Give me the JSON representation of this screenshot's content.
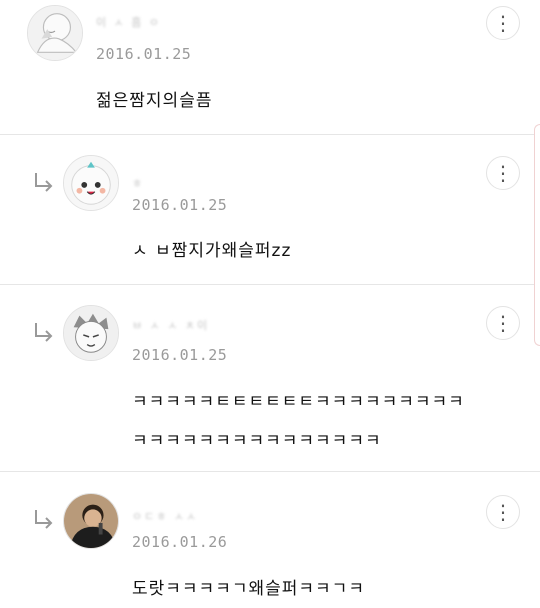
{
  "comments": [
    {
      "username": "이 ㅅ 흠 ㅇ",
      "date": "2016.01.25",
      "text": "젊은짬지의슬픔",
      "is_reply": false
    },
    {
      "username": "ㅎ",
      "date": "2016.01.25",
      "text": "ㅅ ㅂ짬지가왜슬퍼zz",
      "is_reply": true
    },
    {
      "username": "ㅂ ㅅ ㅅ ㅊ이",
      "date": "2016.01.25",
      "text": "ㅋㅋㅋㅋㅋㅌㅌㅌㅌㅌㅌㅋㅋㅋㅋㅋㅋㅋㅋㅋ",
      "text2": "ㅋㅋㅋㅋㅋㅋㅋㅋㅋㅋㅋㅋㅋㅋㅋ",
      "is_reply": true
    },
    {
      "username": "ㅇㄷㅎ ㅅㅅ",
      "date": "2016.01.26",
      "text": "도랏ㅋㅋㅋㅋㄱ왜슬퍼ㅋㅋㄱㅋ",
      "is_reply": true
    }
  ],
  "more_icon": "⋮",
  "icons": [
    "reply-arrow-icon",
    "more-vertical-icon",
    "avatar"
  ]
}
